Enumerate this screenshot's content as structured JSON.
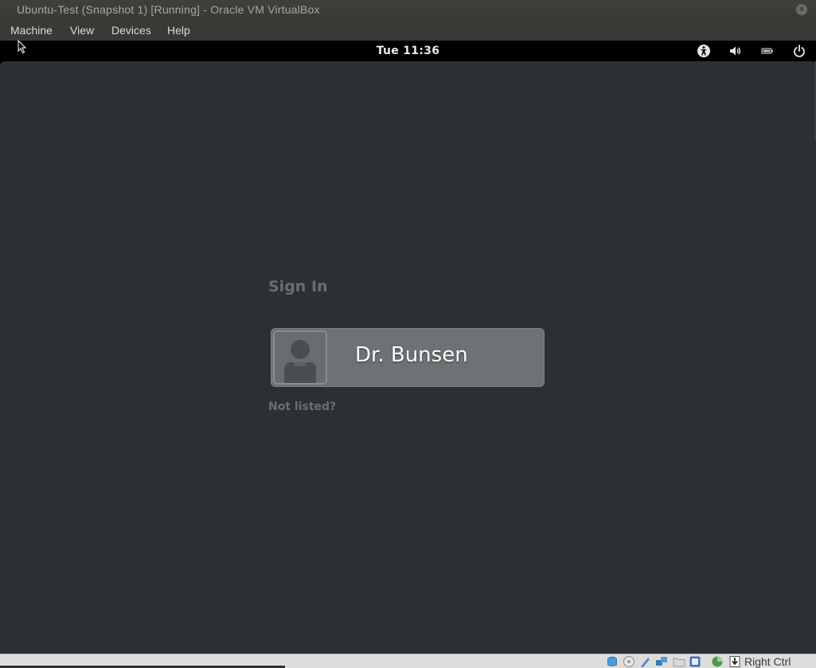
{
  "window": {
    "title": "Ubuntu-Test (Snapshot 1) [Running] - Oracle VM VirtualBox",
    "close_icon": "close-icon"
  },
  "menu": {
    "items": [
      {
        "label": "Machine"
      },
      {
        "label": "View"
      },
      {
        "label": "Devices"
      },
      {
        "label": "Help"
      }
    ]
  },
  "topbar": {
    "clock": "Tue 11:36",
    "icons": [
      "accessibility-icon",
      "volume-icon",
      "battery-icon",
      "power-icon"
    ]
  },
  "login": {
    "heading": "Sign In",
    "user_name": "Dr. Bunsen",
    "not_listed": "Not listed?"
  },
  "statusbar": {
    "icons": [
      "hard-disk-icon",
      "optical-drive-icon",
      "audio-icon",
      "network-icon",
      "usb-icon",
      "shared-folders-icon",
      "display-icon",
      "video-capture-icon",
      "mouse-integration-icon"
    ],
    "host_key": "Right Ctrl"
  }
}
